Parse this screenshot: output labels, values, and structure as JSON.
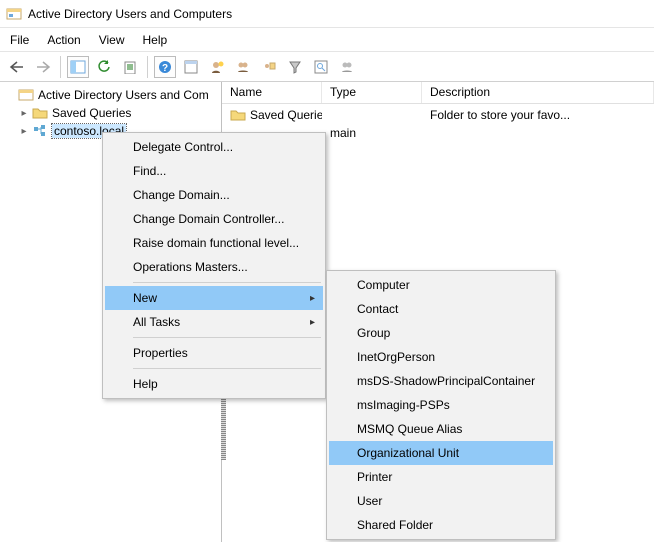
{
  "window": {
    "title": "Active Directory Users and Computers"
  },
  "menubar": {
    "file": "File",
    "action": "Action",
    "view": "View",
    "help": "Help"
  },
  "tree": {
    "root": "Active Directory Users and Com",
    "saved_queries": "Saved Queries",
    "domain": "contoso.local"
  },
  "list": {
    "cols": {
      "name": "Name",
      "type": "Type",
      "desc": "Description"
    },
    "rows": [
      {
        "name": "Saved Queries",
        "type": "",
        "desc": "Folder to store your favo..."
      },
      {
        "name": "",
        "type": "main",
        "desc": ""
      }
    ]
  },
  "ctx1": {
    "delegate": "Delegate Control...",
    "find": "Find...",
    "change_domain": "Change Domain...",
    "change_dc": "Change Domain Controller...",
    "raise": "Raise domain functional level...",
    "opsmasters": "Operations Masters...",
    "new": "New",
    "alltasks": "All Tasks",
    "properties": "Properties",
    "help": "Help"
  },
  "ctx2": {
    "computer": "Computer",
    "contact": "Contact",
    "group": "Group",
    "inetorg": "InetOrgPerson",
    "shadow": "msDS-ShadowPrincipalContainer",
    "psps": "msImaging-PSPs",
    "msmq": "MSMQ Queue Alias",
    "ou": "Organizational Unit",
    "printer": "Printer",
    "user": "User",
    "shared": "Shared Folder"
  }
}
